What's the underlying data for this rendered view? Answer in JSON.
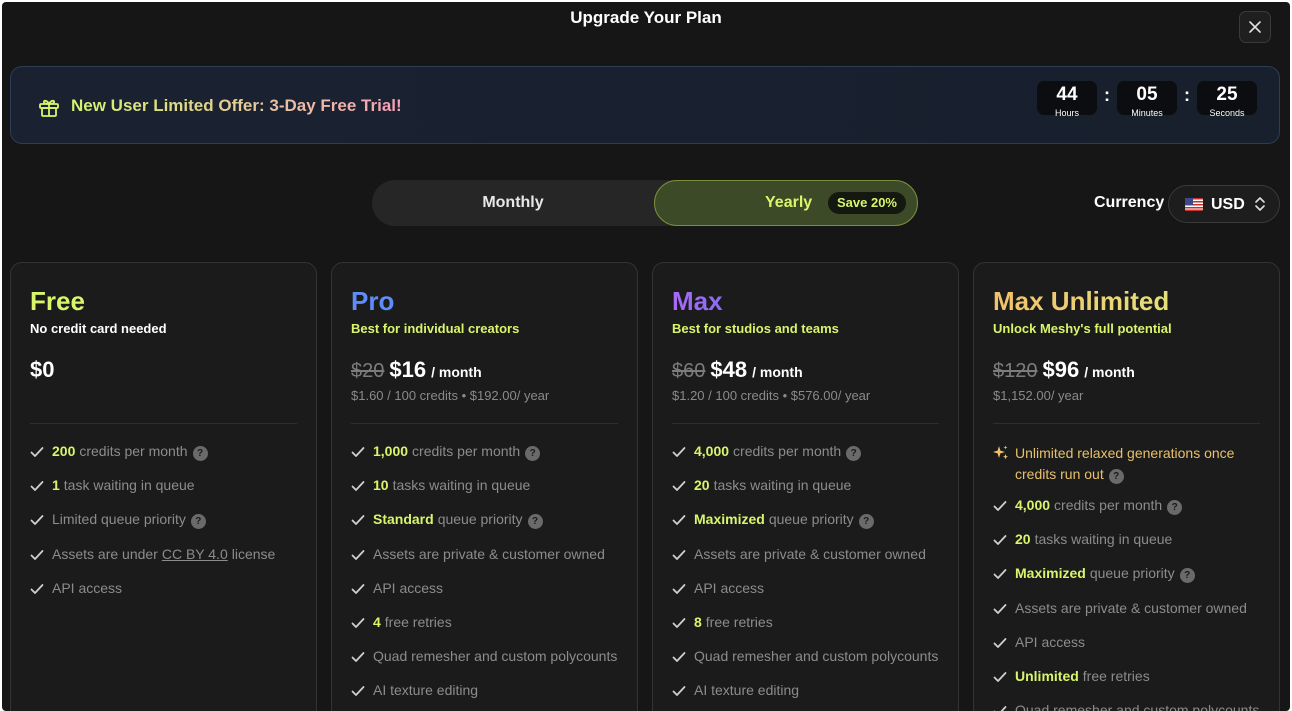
{
  "title": "Upgrade Your Plan",
  "offer": {
    "text": "New User Limited Offer: 3-Day Free Trial!",
    "timer": {
      "hours": "44",
      "hours_label": "Hours",
      "minutes": "05",
      "minutes_label": "Minutes",
      "seconds": "25",
      "seconds_label": "Seconds",
      "separator": ":"
    }
  },
  "billing": {
    "monthly_label": "Monthly",
    "yearly_label": "Yearly",
    "save_badge": "Save 20%",
    "selected": "Yearly"
  },
  "currency": {
    "label": "Currency",
    "value": "USD",
    "flag": "us-flag-icon"
  },
  "plans": [
    {
      "name": "Free",
      "tagline": "No credit card needed",
      "old_price": "",
      "price": "$0",
      "per": "",
      "sub": "",
      "features": [
        {
          "hl": "200",
          "text": "credits per month",
          "info": true
        },
        {
          "hl": "1",
          "text": "task waiting in queue",
          "info": false
        },
        {
          "hl": "",
          "text": "Limited queue priority",
          "info": true
        },
        {
          "pre": "Assets are under",
          "link": "CC BY 4.0",
          "post": "license"
        },
        {
          "hl": "",
          "text": "API access",
          "info": false
        }
      ]
    },
    {
      "name": "Pro",
      "tagline": "Best for individual creators",
      "old_price": "$20",
      "price": "$16",
      "per": "/ month",
      "sub": "$1.60 / 100 credits • $192.00/ year",
      "features": [
        {
          "hl": "1,000",
          "text": "credits per month",
          "info": true
        },
        {
          "hl": "10",
          "text": "tasks waiting in queue",
          "info": false
        },
        {
          "hl": "Standard",
          "text": "queue priority",
          "info": true
        },
        {
          "hl": "",
          "text": "Assets are private & customer owned",
          "info": false
        },
        {
          "hl": "",
          "text": "API access",
          "info": false
        },
        {
          "hl": "4",
          "text": "free retries",
          "info": false
        },
        {
          "hl": "",
          "text": "Quad remesher and custom polycounts",
          "info": false
        },
        {
          "hl": "",
          "text": "AI texture editing",
          "info": false
        }
      ]
    },
    {
      "name": "Max",
      "tagline": "Best for studios and teams",
      "old_price": "$60",
      "price": "$48",
      "per": "/ month",
      "sub": "$1.20 / 100 credits • $576.00/ year",
      "features": [
        {
          "hl": "4,000",
          "text": "credits per month",
          "info": true
        },
        {
          "hl": "20",
          "text": "tasks waiting in queue",
          "info": false
        },
        {
          "hl": "Maximized",
          "text": "queue priority",
          "info": true
        },
        {
          "hl": "",
          "text": "Assets are private & customer owned",
          "info": false
        },
        {
          "hl": "",
          "text": "API access",
          "info": false
        },
        {
          "hl": "8",
          "text": "free retries",
          "info": false
        },
        {
          "hl": "",
          "text": "Quad remesher and custom polycounts",
          "info": false
        },
        {
          "hl": "",
          "text": "AI texture editing",
          "info": false
        }
      ]
    },
    {
      "name": "Max Unlimited",
      "tagline": "Unlock Meshy's full potential",
      "old_price": "$120",
      "price": "$96",
      "per": "/ month",
      "sub": "$1,152.00/ year",
      "special": "Unlimited relaxed generations once credits run out",
      "features": [
        {
          "hl": "4,000",
          "text": "credits per month",
          "info": true
        },
        {
          "hl": "20",
          "text": "tasks waiting in queue",
          "info": false
        },
        {
          "hl": "Maximized",
          "text": "queue priority",
          "info": true
        },
        {
          "hl": "",
          "text": "Assets are private & customer owned",
          "info": false
        },
        {
          "hl": "",
          "text": "API access",
          "info": false
        },
        {
          "hl": "Unlimited",
          "text": "free retries",
          "info": false
        },
        {
          "hl": "",
          "text": "Quad remesher and custom polycounts",
          "info": false
        }
      ]
    }
  ],
  "colors": {
    "accent": "#d8f56c",
    "pro": "#5f8df8",
    "max": "#a86af6",
    "max_unlimited": "#f1c26b",
    "background": "#161616"
  }
}
